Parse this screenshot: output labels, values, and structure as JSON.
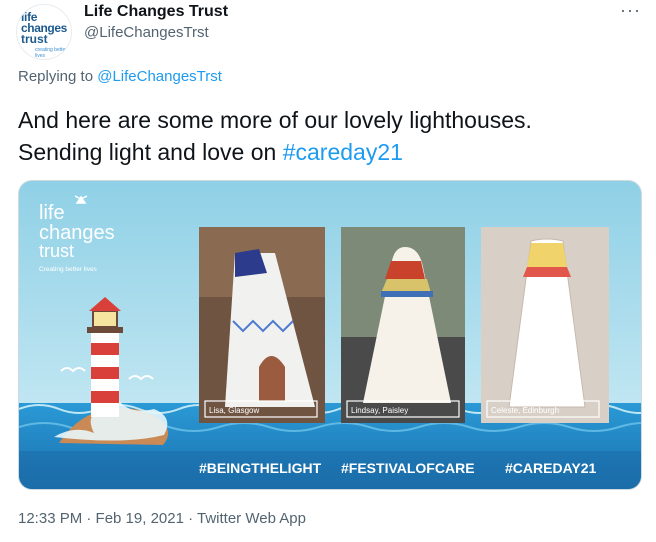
{
  "author": {
    "avatar_text": [
      "life",
      "changes",
      "trust",
      "creating better lives"
    ],
    "name": "Life Changes Trust",
    "handle": "@LifeChangesTrst"
  },
  "reply": {
    "prefix": "Replying to ",
    "to": "@LifeChangesTrst"
  },
  "tweet": {
    "line1": "And here are some more of our lovely lighthouses.",
    "line2_prefix": "Sending light and love on ",
    "hashtag": "#careday21"
  },
  "image": {
    "logo": [
      "life",
      "changes",
      "trust"
    ],
    "logo_tagline": "Creating better lives",
    "photos": [
      {
        "caption": "Lisa, Glasgow"
      },
      {
        "caption": "Lindsay, Paisley"
      },
      {
        "caption": "Celeste, Edinburgh"
      }
    ],
    "hashtags": [
      "#BEINGTHELIGHT",
      "#FESTIVALOFCARE",
      "#CAREDAY21"
    ],
    "colors": {
      "sky": "#a7d9ec",
      "sea": "#1e86c4",
      "banner": "#1c6fa8"
    }
  },
  "meta": {
    "timestamp": "12:33 PM · Feb 19, 2021 · Twitter Web App"
  }
}
